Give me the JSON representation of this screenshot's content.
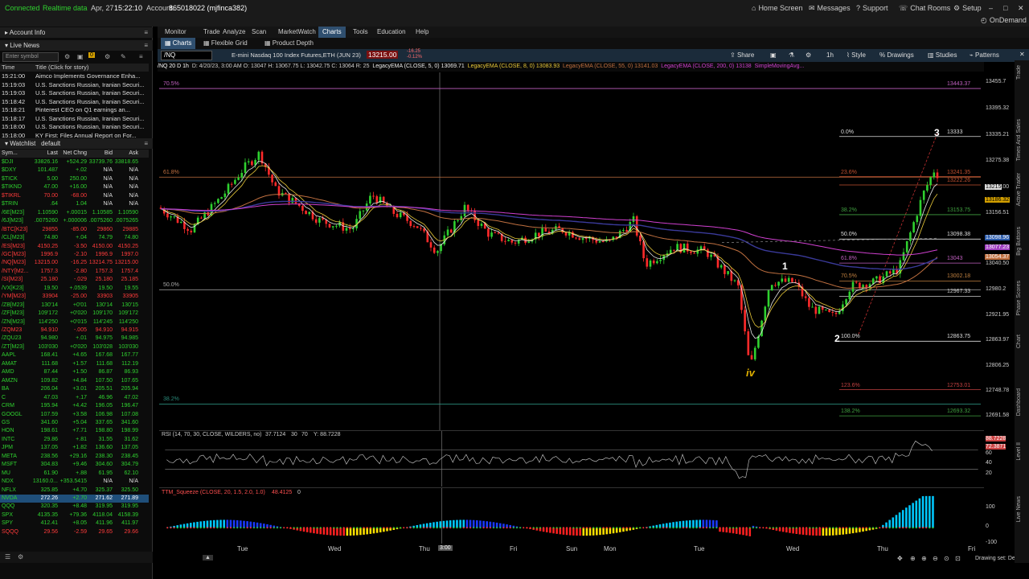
{
  "topbar": {
    "connected": "Connected",
    "realtime": "Realtime data",
    "date": "Apr, 27",
    "time": "15:22:10",
    "account_label": "Account:",
    "account": "865018022 (mjfinca382)",
    "links": [
      "Home Screen",
      "Messages",
      "Support",
      "Chat Rooms",
      "Setup"
    ],
    "ondemand": "OnDemand"
  },
  "leftpanel": {
    "account_info": "Account Info",
    "live_news": "Live News",
    "enter_symbol": "Enter symbol",
    "badge": "0",
    "news_cols": [
      "Time",
      "Title (Click for story)"
    ],
    "news": [
      [
        "15:21:00",
        "Aimco Implements Governance Enha..."
      ],
      [
        "15:19:03",
        "U.S. Sanctions Russian, Iranian Securi..."
      ],
      [
        "15:19:03",
        "U.S. Sanctions Russian, Iranian Securi..."
      ],
      [
        "15:18:42",
        "U.S. Sanctions Russian, Iranian Securi..."
      ],
      [
        "15:18:21",
        "Pinterest CEO on Q1 earnings an..."
      ],
      [
        "15:18:17",
        "U.S. Sanctions Russian, Iranian Securi..."
      ],
      [
        "15:18:00",
        "U.S. Sanctions Russian, Iranian Securi..."
      ],
      [
        "15:18:00",
        "KY First: Files Annual Report on For..."
      ]
    ],
    "watchlist": "Watchlist",
    "watchlist_name": "default",
    "wl_cols": [
      "Sym...",
      "Last",
      "Net Chng",
      "Bid",
      "Ask"
    ],
    "rows": [
      [
        "$DJI",
        "33826.16",
        "+524.29",
        "33739.76",
        "33818.65"
      ],
      [
        "$DXY",
        "101.487",
        "+.02",
        "N/A",
        "N/A"
      ],
      [
        "$TICK",
        "5.00",
        "250.00",
        "N/A",
        "N/A"
      ],
      [
        "$TIKND",
        "47.00",
        "+16.00",
        "N/A",
        "N/A"
      ],
      [
        "$TIKRL",
        "70.00",
        "-68.00",
        "N/A",
        "N/A"
      ],
      [
        "$TRIN",
        ".64",
        "1.04",
        "N/A",
        "N/A"
      ],
      [
        "/6E[M23]",
        "1.10590",
        "+.00015",
        "1.10585",
        "1.10590"
      ],
      [
        "/6J[M23]",
        ".0075260",
        "+.000006",
        ".0075260",
        ".0075265"
      ],
      [
        "/BTC[K23]",
        "29855",
        "-85.00",
        "29860",
        "29885"
      ],
      [
        "/CL[M23]",
        "74.80",
        "+.04",
        "74.79",
        "74.80"
      ],
      [
        "/ES[M23]",
        "4150.25",
        "-3.50",
        "4150.00",
        "4150.25"
      ],
      [
        "/GC[M23]",
        "1996.9",
        "-2.10",
        "1996.9",
        "1997.0"
      ],
      [
        "/NQ[M23]",
        "13215.00",
        "-16.25",
        "13214.75",
        "13215.00"
      ],
      [
        "/NTY[M2...",
        "1757.3",
        "-2.80",
        "1757.3",
        "1757.4"
      ],
      [
        "/SI[M23]",
        "25.180",
        "-.029",
        "25.180",
        "25.185"
      ],
      [
        "/VX[K23]",
        "19.50",
        "+.0539",
        "19.50",
        "19.55"
      ],
      [
        "/YM[M23]",
        "33904",
        "-25.00",
        "33903",
        "33905"
      ],
      [
        "/ZB[M23]",
        "130'14",
        "+0'01",
        "130'14",
        "130'15"
      ],
      [
        "/ZF[M23]",
        "109'172",
        "+0'020",
        "109'170",
        "109'172"
      ],
      [
        "/ZN[M23]",
        "114'250",
        "+0'015",
        "114'245",
        "114'250"
      ],
      [
        "/ZQM23",
        "94.910",
        "-.005",
        "94.910",
        "94.915"
      ],
      [
        "/ZQU23",
        "94.980",
        "+.01",
        "94.975",
        "94.985"
      ],
      [
        "/ZT[M23]",
        "103'030",
        "+0'020",
        "103'028",
        "103'030"
      ],
      [
        "AAPL",
        "168.41",
        "+4.65",
        "167.68",
        "167.77"
      ],
      [
        "AMAT",
        "111.68",
        "+1.57",
        "111.68",
        "112.19"
      ],
      [
        "AMD",
        "87.44",
        "+1.50",
        "86.87",
        "86.93"
      ],
      [
        "AMZN",
        "109.82",
        "+4.84",
        "107.50",
        "107.65"
      ],
      [
        "BA",
        "206.04",
        "+3.01",
        "205.51",
        "205.94"
      ],
      [
        "C",
        "47.03",
        "+.17",
        "46.96",
        "47.02"
      ],
      [
        "CRM",
        "195.94",
        "+4.42",
        "196.05",
        "196.47"
      ],
      [
        "GOOGL",
        "107.59",
        "+3.58",
        "106.98",
        "107.08"
      ],
      [
        "GS",
        "341.60",
        "+5.04",
        "337.65",
        "341.60"
      ],
      [
        "HON",
        "198.61",
        "+7.71",
        "198.80",
        "198.99"
      ],
      [
        "INTC",
        "29.86",
        "+.81",
        "31.55",
        "31.62"
      ],
      [
        "JPM",
        "137.05",
        "+1.82",
        "136.60",
        "137.05"
      ],
      [
        "META",
        "238.56",
        "+29.16",
        "238.30",
        "238.45"
      ],
      [
        "MSFT",
        "304.83",
        "+9.46",
        "304.60",
        "304.79"
      ],
      [
        "MU",
        "61.90",
        "+.88",
        "61.95",
        "62.10"
      ],
      [
        "NDX",
        "13160.0...",
        "+353.5415",
        "N/A",
        "N/A"
      ],
      [
        "NFLX",
        "325.85",
        "+4.70",
        "325.37",
        "325.50"
      ],
      [
        "NVDA",
        "272.26",
        "+2.70",
        "271.62",
        "271.89"
      ],
      [
        "QQQ",
        "320.35",
        "+8.48",
        "319.95",
        "319.95"
      ],
      [
        "SPX",
        "4135.35",
        "+79.36",
        "4118.04",
        "4158.39"
      ],
      [
        "SPY",
        "412.41",
        "+8.05",
        "411.96",
        "411.97"
      ],
      [
        "SQQQ",
        "29.56",
        "-2.59",
        "29.65",
        "29.66"
      ]
    ]
  },
  "nav": {
    "tabs": [
      "Monitor",
      "Trade",
      "Analyze",
      "Scan",
      "MarketWatch",
      "Charts",
      "Tools",
      "Education",
      "Help"
    ],
    "active": "Charts",
    "subtabs": [
      "Charts",
      "Flexible Grid",
      "Product Depth"
    ],
    "symbol": "/NQ",
    "desc": "E-mini Nasdaq 100 Index Futures,ETH (JUN 23)",
    "last": "13215.00",
    "chg": "-16.25",
    "chgpct": "-0.12%",
    "tools": [
      "Share",
      "Style",
      "Drawings",
      "Studies",
      "Patterns"
    ],
    "period": "1h"
  },
  "study_line": {
    "head": "/NQ 20 D 1h",
    "info": "D: 4/20/23, 3:00 AM  O: 13047  H: 13067.75  L: 13042.75  C: 13064  R: 25",
    "ema5": "LegacyEMA (CLOSE, 5, 0)",
    "v5": "13069.71",
    "ema8": "LegacyEMA (CLOSE, 8, 0)",
    "v8": "13083.93",
    "ema55": "LegacyEMA (CLOSE, 55, 0)",
    "v55": "13141.03",
    "ema200": "LegacyEMA (CLOSE, 200, 0)",
    "v200": "13138",
    "sma": "SimpleMovingAvg..."
  },
  "chart": {
    "price_ticks": [
      "13455.7",
      "13395.32",
      "13335.21",
      "13275.38",
      "13215.00",
      "13156.51",
      "13098.96",
      "13040.50",
      "12980.2",
      "12921.95",
      "12863.97",
      "12806.25",
      "12748.78",
      "12691.58"
    ],
    "fib_left": [
      "70.5%",
      "61.8%",
      "50.0%",
      "38.2%"
    ],
    "fib_right": [
      "0.0%",
      "23.6%",
      "38.2%",
      "50.0%",
      "61.8%",
      "70.5%",
      "100.0%",
      "123.6%",
      "138.2%"
    ],
    "fib_right_vals": [
      "13333",
      "13241.35",
      "13222.26",
      "13153.75",
      "13098.38",
      "13043",
      "13002.18",
      "12967.33",
      "12863.75",
      "12753.01",
      "12693.32"
    ],
    "left_vals": [
      "13443.37"
    ],
    "waves": [
      "3",
      "1",
      "2",
      "iv"
    ],
    "price_label": "13215",
    "lvl1": "13186.32",
    "lvl2": "13098.96",
    "lvl3": "13077.23",
    "lvl4": "13054.37",
    "rsi_label": "RSI (14, 70, 30, CLOSE, WILDERS, no)",
    "rsi_val": "37.7124",
    "rsi_a": "30",
    "rsi_b": "70",
    "rsi_y": "Y: 88.7228",
    "rsi_ticks": [
      "88.7228",
      "72.3871",
      "60",
      "40",
      "20"
    ],
    "ttm_label": "TTM_Squeeze (CLOSE, 20, 1.5, 2.0, 1.0)",
    "ttm_val": "48.4125",
    "ttm_zero": "0",
    "ttm_ticks": [
      "100",
      "0",
      "-100"
    ],
    "days": [
      "Tue",
      "Wed",
      "Thu",
      "Fri",
      "Sun",
      "Mon",
      "Tue",
      "Wed",
      "Thu",
      "Fri"
    ],
    "cursor_time": "3:00",
    "drawing_set": "Drawing set: Default"
  },
  "right_tabs": [
    "Trade",
    "Times And Sales",
    "Active Trader",
    "Big Buttons",
    "Phase Scores",
    "Chart",
    "Dashboard",
    "Level II",
    "Live News"
  ],
  "colors": {
    "up": "#2fd12f",
    "down": "#ff3b3b",
    "accent": "#2f4f6f"
  }
}
